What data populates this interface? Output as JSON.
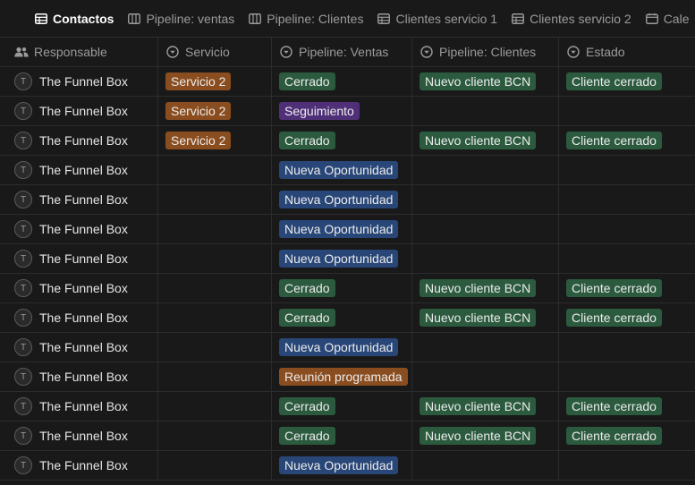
{
  "tabs": [
    {
      "label": "Contactos",
      "icon": "table-icon",
      "active": true
    },
    {
      "label": "Pipeline: ventas",
      "icon": "board-icon",
      "active": false
    },
    {
      "label": "Pipeline: Clientes",
      "icon": "board-icon",
      "active": false
    },
    {
      "label": "Clientes servicio 1",
      "icon": "table-icon",
      "active": false
    },
    {
      "label": "Clientes servicio 2",
      "icon": "table-icon",
      "active": false
    },
    {
      "label": "Cale",
      "icon": "calendar-icon",
      "active": false
    }
  ],
  "columns": {
    "responsable": "Responsable",
    "servicio": "Servicio",
    "pipeline_ventas": "Pipeline: Ventas",
    "pipeline_clientes": "Pipeline: Clientes",
    "estado": "Estado"
  },
  "colors": {
    "orange": "#8a4d1f",
    "green": "#2b5a3e",
    "purple": "#4f3078",
    "blue": "#284677"
  },
  "rows": [
    {
      "initial": "T",
      "owner": "The Funnel Box",
      "servicio": "Servicio 2",
      "ventas": "Cerrado",
      "clientes": "Nuevo cliente BCN",
      "estado": "Cliente cerrado"
    },
    {
      "initial": "T",
      "owner": "The Funnel Box",
      "servicio": "Servicio 2",
      "ventas": "Seguimiento",
      "clientes": "",
      "estado": ""
    },
    {
      "initial": "T",
      "owner": "The Funnel Box",
      "servicio": "Servicio 2",
      "ventas": "Cerrado",
      "clientes": "Nuevo cliente BCN",
      "estado": "Cliente cerrado"
    },
    {
      "initial": "T",
      "owner": "The Funnel Box",
      "servicio": "",
      "ventas": "Nueva Oportunidad",
      "clientes": "",
      "estado": ""
    },
    {
      "initial": "T",
      "owner": "The Funnel Box",
      "servicio": "",
      "ventas": "Nueva Oportunidad",
      "clientes": "",
      "estado": ""
    },
    {
      "initial": "T",
      "owner": "The Funnel Box",
      "servicio": "",
      "ventas": "Nueva Oportunidad",
      "clientes": "",
      "estado": ""
    },
    {
      "initial": "T",
      "owner": "The Funnel Box",
      "servicio": "",
      "ventas": "Nueva Oportunidad",
      "clientes": "",
      "estado": ""
    },
    {
      "initial": "T",
      "owner": "The Funnel Box",
      "servicio": "",
      "ventas": "Cerrado",
      "clientes": "Nuevo cliente BCN",
      "estado": "Cliente cerrado"
    },
    {
      "initial": "T",
      "owner": "The Funnel Box",
      "servicio": "",
      "ventas": "Cerrado",
      "clientes": "Nuevo cliente BCN",
      "estado": "Cliente cerrado"
    },
    {
      "initial": "T",
      "owner": "The Funnel Box",
      "servicio": "",
      "ventas": "Nueva Oportunidad",
      "clientes": "",
      "estado": ""
    },
    {
      "initial": "T",
      "owner": "The Funnel Box",
      "servicio": "",
      "ventas": "Reunión programada",
      "clientes": "",
      "estado": ""
    },
    {
      "initial": "T",
      "owner": "The Funnel Box",
      "servicio": "",
      "ventas": "Cerrado",
      "clientes": "Nuevo cliente BCN",
      "estado": "Cliente cerrado"
    },
    {
      "initial": "T",
      "owner": "The Funnel Box",
      "servicio": "",
      "ventas": "Cerrado",
      "clientes": "Nuevo cliente BCN",
      "estado": "Cliente cerrado"
    },
    {
      "initial": "T",
      "owner": "The Funnel Box",
      "servicio": "",
      "ventas": "Nueva Oportunidad",
      "clientes": "",
      "estado": ""
    }
  ]
}
